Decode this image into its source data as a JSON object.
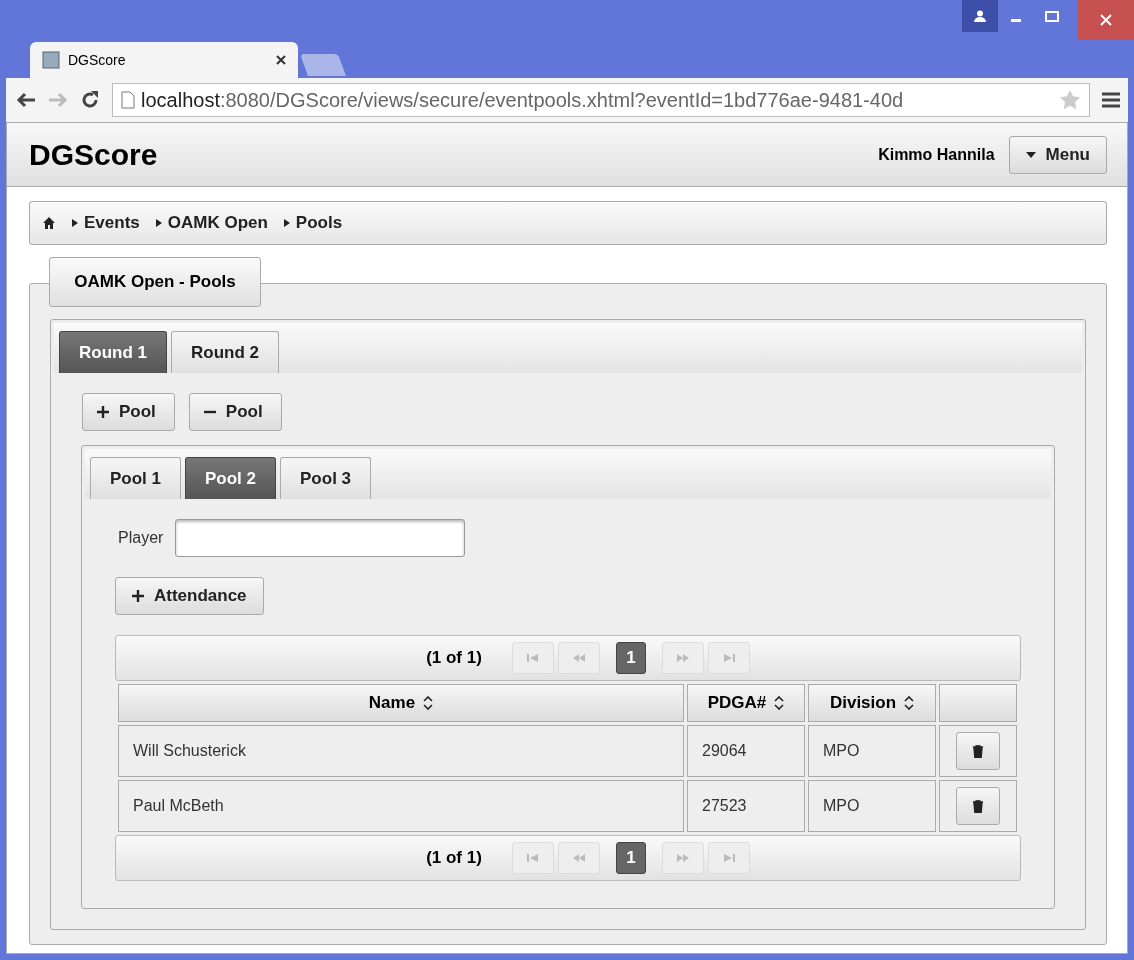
{
  "browser": {
    "tabs": [
      {
        "title": "DGScore",
        "selected": true
      }
    ],
    "url": {
      "host": "localhost",
      "path": ":8080/DGScore/views/secure/eventpools.xhtml?eventId=1bd776ae-9481-40d"
    }
  },
  "header": {
    "title": "DGScore",
    "user": "Kimmo Hannila",
    "menu": "Menu"
  },
  "breadcrumb": [
    "Events",
    "OAMK Open",
    "Pools"
  ],
  "panel": {
    "title": "OAMK Open - Pools"
  },
  "round_tabs": [
    {
      "label": "Round 1",
      "selected": true
    },
    {
      "label": "Round 2",
      "selected": false
    }
  ],
  "pool_buttons": [
    {
      "kind": "add",
      "label": "Pool"
    },
    {
      "kind": "remove",
      "label": "Pool"
    }
  ],
  "pool_tabs": [
    {
      "label": "Pool 1",
      "selected": false
    },
    {
      "label": "Pool 2",
      "selected": true
    },
    {
      "label": "Pool 3",
      "selected": false
    }
  ],
  "player": {
    "label": "Player"
  },
  "attendance_button": "Attendance",
  "paginators": [
    {
      "report": "(1 of 1)",
      "pages": [
        {
          "label": "1",
          "selected": true
        }
      ]
    },
    {
      "report": "(1 of 1)",
      "pages": [
        {
          "label": "1",
          "selected": true
        }
      ]
    }
  ],
  "table": {
    "columns": [
      "Name",
      "PDGA#",
      "Division"
    ],
    "rows": [
      {
        "name": "Will Schusterick",
        "pdga": "29064",
        "division": "MPO"
      },
      {
        "name": "Paul McBeth",
        "pdga": "27523",
        "division": "MPO"
      }
    ]
  }
}
